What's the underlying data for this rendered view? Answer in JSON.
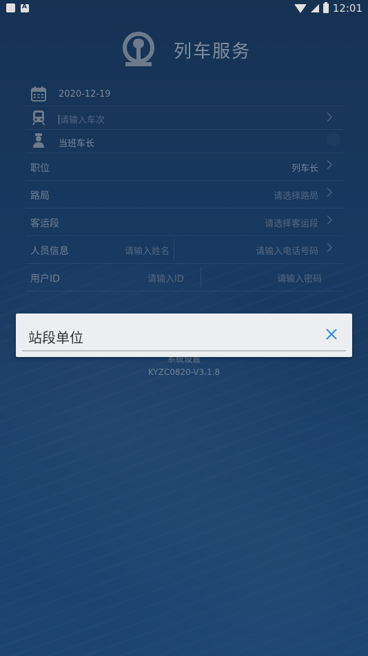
{
  "status_bar": {
    "time": "12:01"
  },
  "header": {
    "title": "列车服务"
  },
  "form": {
    "date": "2020-12-19",
    "train_placeholder": "请输入车次",
    "duty_label": "当班车长",
    "position": {
      "label": "职位",
      "value": "列车长"
    },
    "bureau": {
      "label": "路局",
      "placeholder": "请选择路局"
    },
    "depot": {
      "label": "客运段",
      "placeholder": "请选择客运段"
    },
    "staff": {
      "label": "人员信息",
      "name_placeholder": "请输入姓名",
      "phone_placeholder": "请输入电话号码"
    },
    "user": {
      "label": "用户ID",
      "id_placeholder": "请输入ID",
      "password_placeholder": "请输入密码"
    }
  },
  "footer": {
    "system_settings": "系统设置",
    "version": "KYZC0820-V3.1.8"
  },
  "dialog": {
    "title": "站段单位"
  }
}
